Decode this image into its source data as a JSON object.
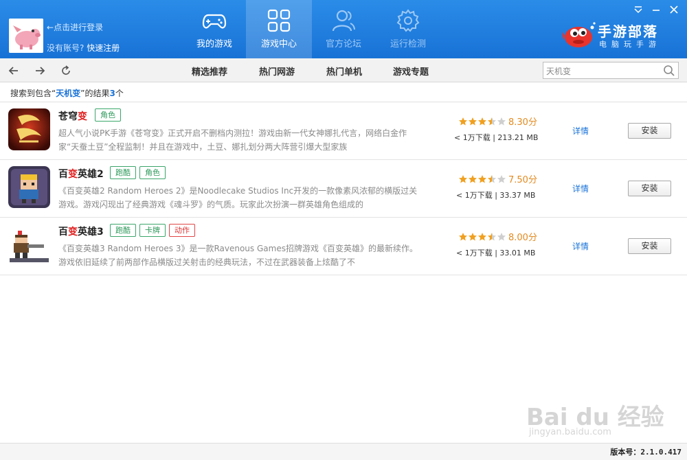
{
  "header": {
    "login_text": "点击进行登录",
    "no_account_text": "没有账号?",
    "register_text": "快速注册",
    "nav": [
      {
        "label": "我的游戏",
        "icon": "gamepad-icon",
        "active": false
      },
      {
        "label": "游戏中心",
        "icon": "grid-icon",
        "active": true
      },
      {
        "label": "官方论坛",
        "icon": "people-icon",
        "active": false
      },
      {
        "label": "运行检测",
        "icon": "gear-icon",
        "active": false
      }
    ],
    "brand_title": "手游部落",
    "brand_sub": "电脑玩手游"
  },
  "toolbar": {
    "tabs": [
      "精选推荐",
      "热门网游",
      "热门单机",
      "游戏专题"
    ],
    "search_value": "天机变"
  },
  "summary": {
    "prefix": "搜索到包含“",
    "keyword": "天机变",
    "middle": "”的结果",
    "count": "3",
    "suffix": "个"
  },
  "games": [
    {
      "name_pre": "苍穹",
      "name_hl": "变",
      "tags": [
        {
          "label": "角色",
          "color": "green"
        }
      ],
      "desc": "超人气小说PK手游《苍穹变》正式开启不删档内测拉！游戏由新一代女神娜扎代言，网络白金作家“天蚕土豆”全程监制！并且在游戏中，土豆、娜扎划分两大阵营引爆大型家族",
      "rating": 3.5,
      "score": "8.30分",
      "downloads": "< 1万下载",
      "size": "213.21 MB",
      "detail": "详情",
      "install": "安装"
    },
    {
      "name_pre": "百",
      "name_hl": "变",
      "name_post": "英雄2",
      "tags": [
        {
          "label": "跑酷",
          "color": "green"
        },
        {
          "label": "角色",
          "color": "green"
        }
      ],
      "desc": "《百变英雄2 Random Heroes 2》是Noodlecake Studios Inc开发的一款像素风浓郁的横版过关游戏。游戏闪现出了经典游戏《魂斗罗》的气质。玩家此次扮演一群英雄角色组成的",
      "rating": 3.5,
      "score": "7.50分",
      "downloads": "< 1万下载",
      "size": "33.37 MB",
      "detail": "详情",
      "install": "安装"
    },
    {
      "name_pre": "百",
      "name_hl": "变",
      "name_post": "英雄3",
      "tags": [
        {
          "label": "跑酷",
          "color": "green"
        },
        {
          "label": "卡牌",
          "color": "green"
        },
        {
          "label": "动作",
          "color": "red"
        }
      ],
      "desc": "《百变英雄3 Random Heroes 3》是一款Ravenous Games招牌游戏《百变英雄》的最新续作。游戏依旧延续了前两部作品横版过关射击的经典玩法，不过在武器装备上炫酷了不",
      "rating": 3.5,
      "score": "8.00分",
      "downloads": "< 1万下载",
      "size": "33.01 MB",
      "detail": "详情",
      "install": "安装"
    }
  ],
  "footer": {
    "version": "版本号：2.1.0.417"
  },
  "watermark": {
    "line1": "Bai du 经验",
    "line2": "jingyan.baidu.com"
  }
}
